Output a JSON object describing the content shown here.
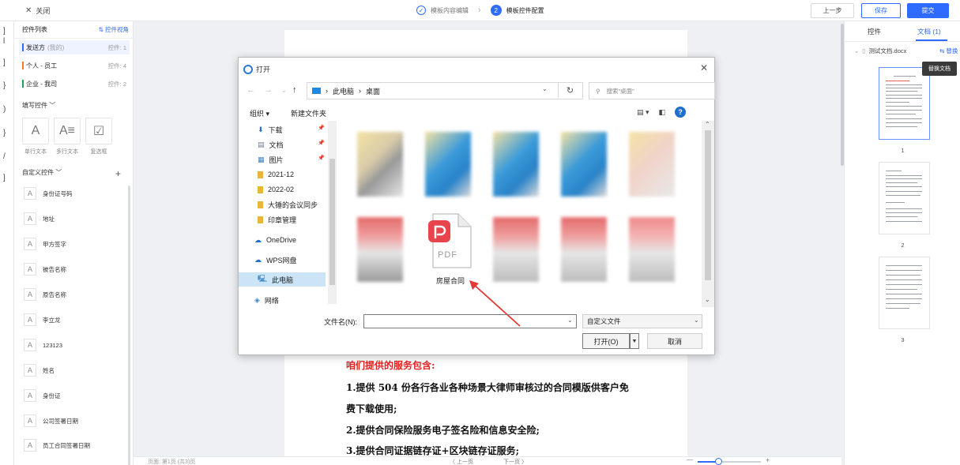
{
  "topbar": {
    "close_label": "关闭",
    "steps": [
      {
        "number": "",
        "label": "模板内容编辑",
        "state": "done"
      },
      {
        "number": "2",
        "label": "模板控件配置",
        "state": "active"
      }
    ],
    "prev_label": "上一步",
    "save_label": "保存",
    "submit_label": "提交",
    "accent": "#2f6bff"
  },
  "left_rail": [
    "]",
    "l",
    "]",
    "}",
    ")",
    "}",
    "/",
    "]"
  ],
  "left_panel": {
    "title": "控件列表",
    "view_link": "⇅ 控件视角",
    "parties": [
      {
        "name": "发送方",
        "sub": "(我的)",
        "count": "控件: 1",
        "color": "#2f6bff",
        "selected": true
      },
      {
        "name": "个人 - 员工",
        "sub": "",
        "count": "控件: 4",
        "color": "#ff7a1a",
        "selected": false
      },
      {
        "name": "企业 - 我司",
        "sub": "",
        "count": "控件: 2",
        "color": "#1aa55e",
        "selected": false
      }
    ],
    "fill_section": "填写控件 ﹀",
    "fill_controls": [
      {
        "glyph": "A",
        "label": "单行文本"
      },
      {
        "glyph": "A≡",
        "label": "多行文本"
      },
      {
        "glyph": "☑",
        "label": "复选框"
      }
    ],
    "custom_section": "自定义控件 ﹀",
    "add_label": "+",
    "custom_controls": [
      "身份证号码",
      "地址",
      "甲方签字",
      "被告名称",
      "原告名称",
      "李立龙",
      "123123",
      "姓名",
      "身份证",
      "公司签署日期",
      "员工合同签署日期"
    ]
  },
  "document": {
    "lines": [
      {
        "text": "咱们提供的服务包含:",
        "red": true
      },
      {
        "text": "1.提供 504 份各行各业各种场景大律师审核过的合同模版供客户免",
        "red": false
      },
      {
        "text": "费下载使用;",
        "red": false
      },
      {
        "text": "2.提供合同保险服务电子签名险和信息安全险;",
        "red": false
      },
      {
        "text": "3.提供合同证据链存证+区块链存证服务;",
        "red": false
      }
    ]
  },
  "statusbar": {
    "pages": "页面: 第1页 (共3)页",
    "prev": "〈 上一页",
    "next": "下一页 〉",
    "zoom_minus": "—",
    "zoom_plus": "+"
  },
  "right_panel": {
    "tab_controls": "控件",
    "tab_docs": "文档 (1)",
    "file_name": "测试文档.docx",
    "replace_label": "⇆ 替换",
    "tooltip": "替换文档",
    "page_numbers": [
      "1",
      "2",
      "3"
    ]
  },
  "dialog": {
    "title": "打开",
    "close_glyph": "✕",
    "breadcrumb": [
      "此电脑",
      "桌面"
    ],
    "search_placeholder": "搜索\"桌面\"",
    "organize": "组织 ▾",
    "new_folder": "新建文件夹",
    "nav_items": [
      {
        "label": "下载",
        "icon": "download-icon",
        "pinned": true
      },
      {
        "label": "文档",
        "icon": "document-icon",
        "pinned": true
      },
      {
        "label": "图片",
        "icon": "picture-icon",
        "pinned": true
      },
      {
        "label": "2021-12",
        "icon": "folder-icon",
        "pinned": false
      },
      {
        "label": "2022-02",
        "icon": "folder-icon",
        "pinned": false
      },
      {
        "label": "大锤的会议同步",
        "icon": "folder-icon",
        "pinned": false
      },
      {
        "label": "印章管理",
        "icon": "folder-icon",
        "pinned": false
      },
      {
        "label": "OneDrive",
        "icon": "cloud-icon",
        "pinned": false
      },
      {
        "label": "WPS网盘",
        "icon": "cloud-icon",
        "pinned": false
      },
      {
        "label": "此电脑",
        "icon": "computer-icon",
        "pinned": false,
        "selected": true
      },
      {
        "label": "网络",
        "icon": "network-icon",
        "pinned": false
      }
    ],
    "pdf_file_label": "房屋合同",
    "pdf_badge": "PDF",
    "filename_label": "文件名(N):",
    "filename_value": "",
    "filetype_value": "自定义文件",
    "open_label": "打开(O)",
    "cancel_label": "取消"
  }
}
